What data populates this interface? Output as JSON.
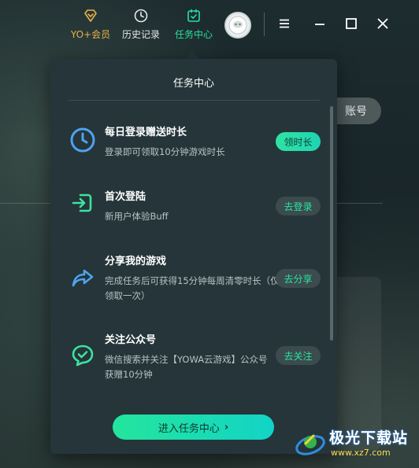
{
  "nav": {
    "vip_label": "YO+会员",
    "history_label": "历史记录",
    "task_label": "任务中心"
  },
  "background": {
    "account_text": "账号"
  },
  "panel": {
    "title": "任务中心",
    "tasks": [
      {
        "name": "每日登录赠送时长",
        "desc": "登录即可领取10分钟游戏时长",
        "button": "领时长",
        "icon": "clock-icon"
      },
      {
        "name": "首次登陆",
        "desc": "新用户体验Buff",
        "button": "去登录",
        "icon": "login-arrow-icon"
      },
      {
        "name": "分享我的游戏",
        "desc": "完成任务后可获得15分钟每周清零时长（仅能领取一次）",
        "button": "去分享",
        "icon": "share-icon"
      },
      {
        "name": "关注公众号",
        "desc": "微信搜索并关注【YOWA云游戏】公众号获赠10分钟",
        "button": "去关注",
        "icon": "chat-check-icon"
      }
    ],
    "enter_button": "进入任务中心",
    "enter_chevron": "›"
  },
  "watermark": {
    "title": "极光下载站",
    "url": "www.xz7.com"
  },
  "colors": {
    "accent": "#27e0a0",
    "vip": "#e8b24a",
    "panel_bg": "#25353a"
  }
}
